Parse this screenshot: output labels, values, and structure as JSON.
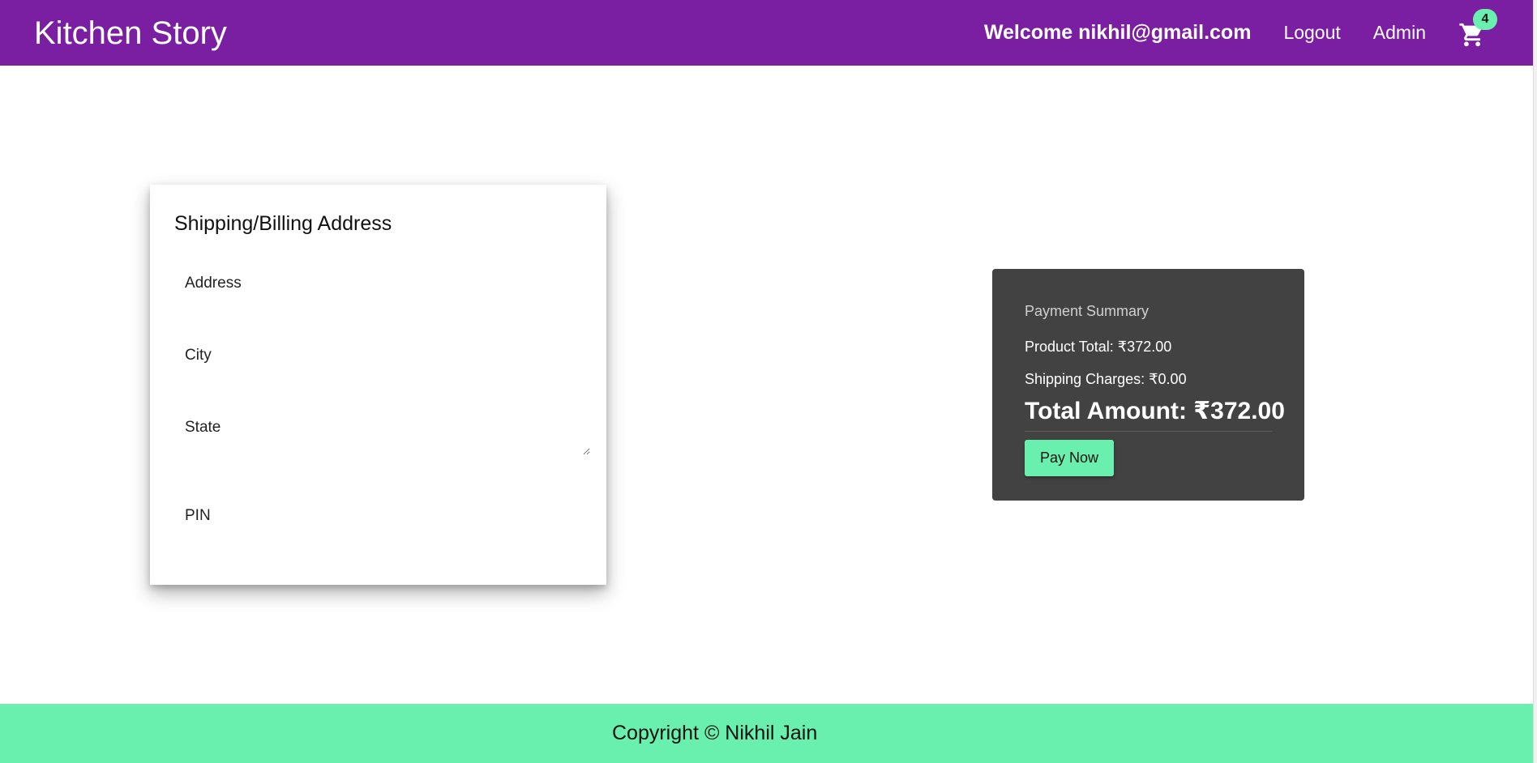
{
  "header": {
    "brand": "Kitchen Story",
    "welcome": "Welcome nikhil@gmail.com",
    "logout": "Logout",
    "admin": "Admin",
    "cart_count": "4",
    "cart_icon": "shopping-cart-icon"
  },
  "address_form": {
    "title": "Shipping/Billing Address",
    "address_placeholder": "Address",
    "city_placeholder": "City",
    "state_placeholder": "State",
    "pin_placeholder": "PIN"
  },
  "payment_summary": {
    "heading": "Payment Summary",
    "product_total": "Product Total: ₹372.00",
    "shipping_charges": "Shipping Charges: ₹0.00",
    "total_amount": "Total Amount: ₹372.00",
    "pay_button": "Pay Now"
  },
  "footer": {
    "copyright": "Copyright © Nikhil Jain"
  },
  "colors": {
    "navbar": "#7b1fa2",
    "accent": "#69f0ae",
    "summary_bg": "#424242"
  }
}
